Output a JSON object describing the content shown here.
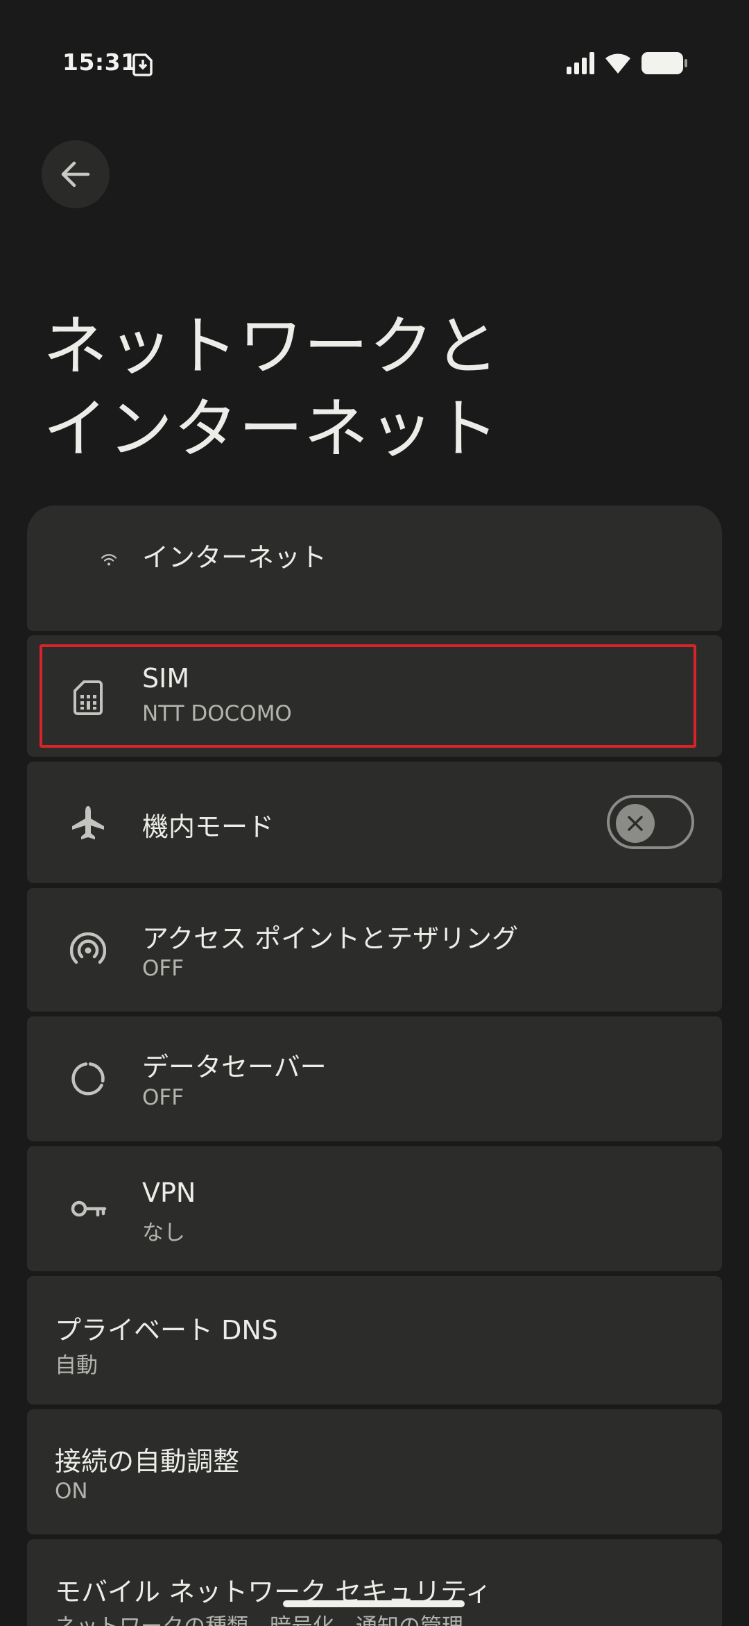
{
  "status_bar": {
    "time": "15:31"
  },
  "header": {
    "title_line1": "ネットワークと",
    "title_line2": "インターネット"
  },
  "items": {
    "internet": {
      "title": "インターネット"
    },
    "sim": {
      "title": "SIM",
      "subtitle": "NTT DOCOMO"
    },
    "airplane": {
      "title": "機内モード",
      "toggle_on": false
    },
    "hotspot": {
      "title": "アクセス ポイントとテザリング",
      "subtitle": "OFF"
    },
    "data_saver": {
      "title": "データセーバー",
      "subtitle": "OFF"
    },
    "vpn": {
      "title": "VPN",
      "subtitle": "なし"
    },
    "private_dns": {
      "title": "プライベート DNS",
      "subtitle": "自動"
    },
    "adaptive": {
      "title": "接続の自動調整",
      "subtitle": "ON"
    },
    "mobile_security": {
      "title": "モバイル ネットワーク セキュリティ",
      "subtitle": "ネットワークの種類、暗号化、通知の管理"
    }
  },
  "colors": {
    "background": "#191a19",
    "card": "#2c2d2b",
    "highlight": "#d8232a"
  }
}
